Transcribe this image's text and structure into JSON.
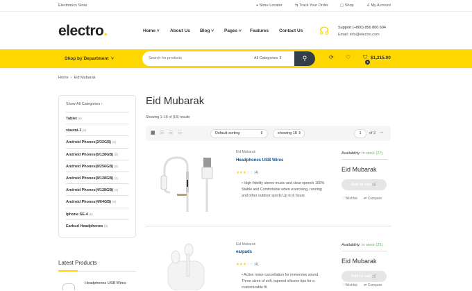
{
  "topbar": {
    "store": "Electronics Store",
    "locator": "Store Locator",
    "track": "Track Your Order",
    "shop": "Shop",
    "account": "My Account"
  },
  "header": {
    "logo": "electro",
    "logo_dot": ".",
    "nav": [
      "Home",
      "About Us",
      "Blog",
      "Pages",
      "Features",
      "Contact Us"
    ],
    "support": "Support (+800) 856 800 604",
    "email": "Email: info@electro.com"
  },
  "bar": {
    "department": "Shop by Department",
    "search_placeholder": "Search for products",
    "category": "All Categories",
    "cart_total": "$1,215.00",
    "cart_count": "4"
  },
  "breadcrumb": [
    "Home",
    "Eid Mubarak"
  ],
  "sidebar": {
    "show_all": "Show All Categories",
    "categories": [
      {
        "name": "Tablet",
        "count": "(8)"
      },
      {
        "name": "xiaomi-1",
        "count": "(8)"
      },
      {
        "name": "Android Phones(2/32GB)",
        "count": "(8)"
      },
      {
        "name": "Android Phones(6/128GB)",
        "count": "(8)"
      },
      {
        "name": "Android Phones(8/256GB)",
        "count": "(8)"
      },
      {
        "name": "Android Phones(8/128GB)",
        "count": "(1)"
      },
      {
        "name": "Android Phones(4/128GB)",
        "count": "(8)"
      },
      {
        "name": "Android Phones(4/64GB)",
        "count": "(8)"
      },
      {
        "name": "Iphone SE-4",
        "count": "(8)"
      },
      {
        "name": "Earbud Headphones",
        "count": "(8)"
      }
    ],
    "latest_title": "Latest Products",
    "latest": [
      {
        "name": "Headphones USB Wires"
      }
    ]
  },
  "main": {
    "title": "Eid Mubarak",
    "showing": "Showing 1–18 of (18) results",
    "sorting": "Default sorting",
    "per_page": "showing 18",
    "page": "1",
    "of_pages": "of 2"
  },
  "products": [
    {
      "category": "Eid Mubarak",
      "name": "Headphones USB Wires",
      "reviews": "(4)",
      "desc": "High-fidelity stereo music and clear speech 100% Stable and Comfortable when exercising, running and other outdoor sports Up to 6 hours",
      "availability_label": "Availability:",
      "availability": "In stock (27)",
      "price": "Eid Mubarak",
      "add": "Add to cart",
      "wishlist": "Wishlist",
      "compare": "Compare"
    },
    {
      "category": "Eid Mubarak",
      "name": "earpads",
      "reviews": "(4)",
      "desc": "Active noise cancellation for immersive sound Three sizes of soft, tapered silicone tips for a customizable fit",
      "availability_label": "Availability:",
      "availability": "In stock (25)",
      "price": "Eid Mubarak",
      "add": "Add to cart",
      "wishlist": "Wishlist",
      "compare": "Compare"
    }
  ]
}
